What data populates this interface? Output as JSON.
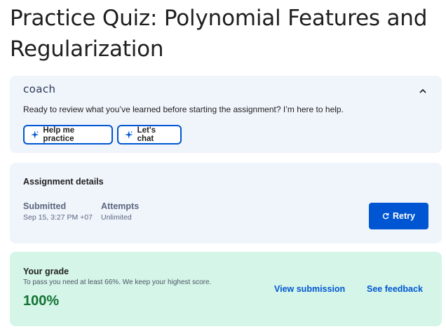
{
  "page": {
    "title": "Practice Quiz: Polynomial Features and Regularization"
  },
  "coach": {
    "logo": "coach",
    "collapse_icon": "chevron-up-icon",
    "message": "Ready to review what you’ve learned before starting the assignment? I’m here to help.",
    "buttons": [
      {
        "label": "Help me practice",
        "icon": "sparkle-icon"
      },
      {
        "label": "Let's chat",
        "icon": "sparkle-icon"
      }
    ]
  },
  "details": {
    "heading": "Assignment details",
    "submitted_label": "Submitted",
    "submitted_value": "Sep 15, 3:27 PM +07",
    "attempts_label": "Attempts",
    "attempts_value": "Unlimited",
    "retry_label": "Retry",
    "retry_icon": "refresh-icon"
  },
  "grade": {
    "heading": "Your grade",
    "note": "To pass you need at least 66%. We keep your highest score.",
    "score": "100%",
    "view_submission": "View submission",
    "see_feedback": "See feedback"
  },
  "colors": {
    "accent": "#0056d2",
    "coach_bg": "#f0f4fb",
    "grade_bg": "#d4f5e8",
    "score": "#137333"
  }
}
